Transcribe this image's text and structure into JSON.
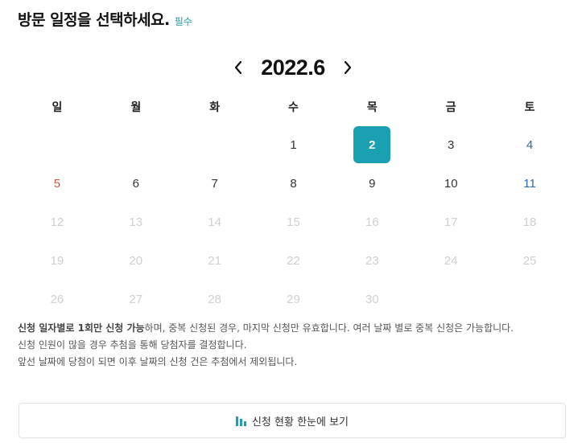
{
  "header": {
    "title": "방문 일정을 선택하세요.",
    "required": "필수"
  },
  "calendar": {
    "month_label": "2022.6",
    "weekdays": [
      "일",
      "월",
      "화",
      "수",
      "목",
      "금",
      "토"
    ],
    "leading_blanks": 3,
    "days": [
      {
        "d": "1",
        "state": "enabled"
      },
      {
        "d": "2",
        "state": "selected"
      },
      {
        "d": "3",
        "state": "enabled"
      },
      {
        "d": "4",
        "state": "enabled"
      },
      {
        "d": "5",
        "state": "enabled"
      },
      {
        "d": "6",
        "state": "enabled"
      },
      {
        "d": "7",
        "state": "enabled"
      },
      {
        "d": "8",
        "state": "enabled"
      },
      {
        "d": "9",
        "state": "enabled"
      },
      {
        "d": "10",
        "state": "enabled"
      },
      {
        "d": "11",
        "state": "enabled"
      },
      {
        "d": "12",
        "state": "disabled"
      },
      {
        "d": "13",
        "state": "disabled"
      },
      {
        "d": "14",
        "state": "disabled"
      },
      {
        "d": "15",
        "state": "disabled"
      },
      {
        "d": "16",
        "state": "disabled"
      },
      {
        "d": "17",
        "state": "disabled"
      },
      {
        "d": "18",
        "state": "disabled"
      },
      {
        "d": "19",
        "state": "disabled"
      },
      {
        "d": "20",
        "state": "disabled"
      },
      {
        "d": "21",
        "state": "disabled"
      },
      {
        "d": "22",
        "state": "disabled"
      },
      {
        "d": "23",
        "state": "disabled"
      },
      {
        "d": "24",
        "state": "disabled"
      },
      {
        "d": "25",
        "state": "disabled"
      },
      {
        "d": "26",
        "state": "disabled"
      },
      {
        "d": "27",
        "state": "disabled"
      },
      {
        "d": "28",
        "state": "disabled"
      },
      {
        "d": "29",
        "state": "disabled"
      },
      {
        "d": "30",
        "state": "disabled"
      }
    ]
  },
  "notes": {
    "line1_bold": "신청 일자별로 1회만 신청 가능",
    "line1_rest": "하며, 중복 신청된 경우, 마지막 신청만 유효합니다. 여러 날짜 별로 중복 신청은 가능합니다.",
    "line2": "신청 인원이 많을 경우 추첨을 통해 당첨자를 결정합니다.",
    "line3": "앞선 날짜에 당첨이 되면 이후 날짜의 신청 건은 추첨에서 제외됩니다."
  },
  "view_button": {
    "label": "신청 현황 한눈에 보기",
    "icon": "bar-chart-icon"
  },
  "colors": {
    "accent": "#1ba0b2",
    "sunday": "#d9534f",
    "saturday": "#2b6cb0",
    "disabled": "#cfcfcf"
  }
}
